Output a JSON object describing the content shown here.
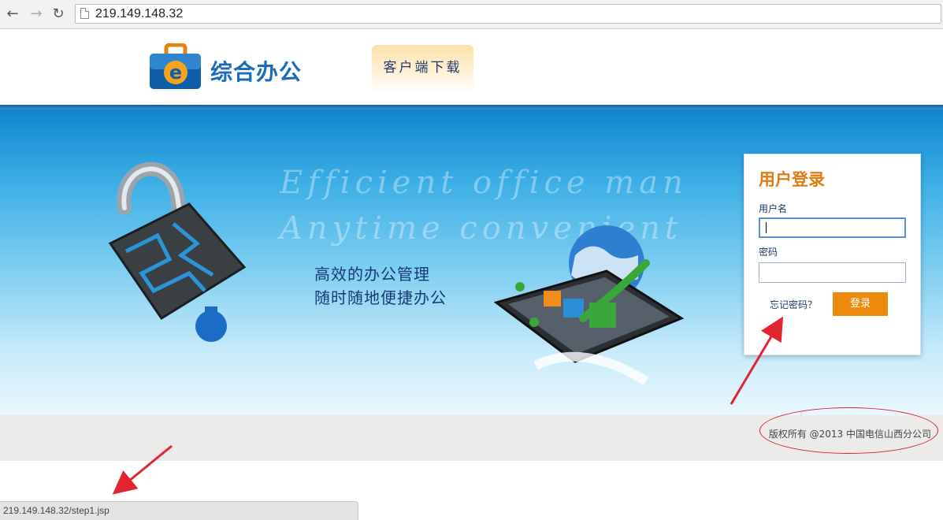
{
  "browser": {
    "url": "219.149.148.32",
    "back_icon": "arrow-left",
    "forward_icon": "arrow-right",
    "reload_icon": "reload",
    "status_url": "219.149.148.32/step1.jsp"
  },
  "header": {
    "logo_text": "综合办公",
    "logo_letter": "e",
    "download_label": "客户端下载"
  },
  "banner": {
    "bg_line1": "Efficient office man",
    "bg_line2": "Anytime convenient",
    "slogan_line1": "高效的办公管理",
    "slogan_line2": "随时随地便捷办公"
  },
  "login": {
    "title": "用户登录",
    "username_label": "用户名",
    "username_value": "",
    "password_label": "密码",
    "password_value": "",
    "forgot_label": "忘记密码？",
    "submit_label": "登录"
  },
  "footer": {
    "copyright": "版权所有 @2013 中国电信山西分公司"
  },
  "colors": {
    "accent_orange": "#ec8a0e",
    "brand_blue": "#1a6cb8",
    "annotation_red": "#d9202a"
  }
}
